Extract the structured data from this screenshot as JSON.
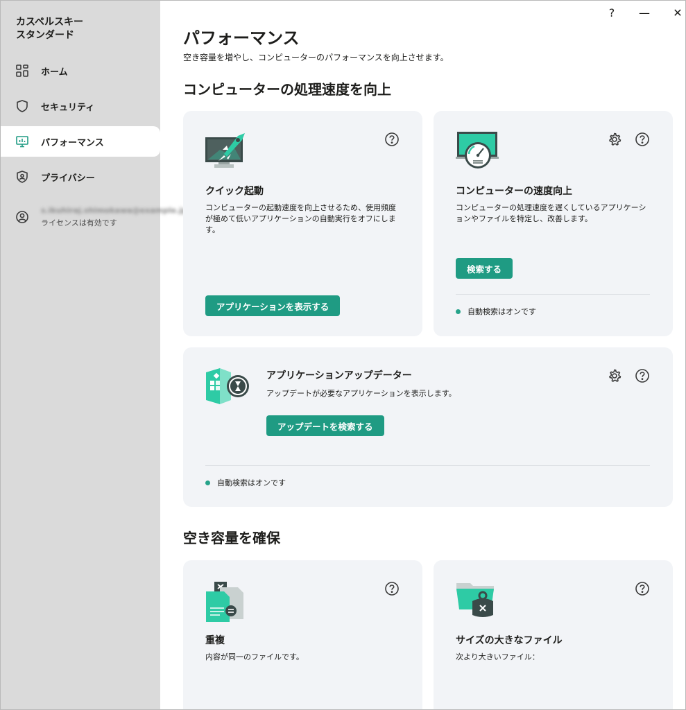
{
  "app": {
    "title": "カスペルスキー\nスタンダード",
    "window_controls": [
      "?",
      "—",
      "✕"
    ]
  },
  "sidebar": {
    "items": [
      {
        "label": "ホーム",
        "icon": "grid-icon"
      },
      {
        "label": "セキュリティ",
        "icon": "shield-icon"
      },
      {
        "label": "パフォーマンス",
        "icon": "monitor-icon",
        "active": true
      },
      {
        "label": "プライバシー",
        "icon": "privacy-shield-icon"
      }
    ],
    "account": {
      "email": "s.ikuhiraj.shimokawa@example.jp",
      "status": "ライセンスは有効です"
    }
  },
  "main": {
    "title": "パフォーマンス",
    "subtitle": "空き容量を増やし、コンピューターのパフォーマンスを向上させます。",
    "section1": "コンピューターの処理速度を向上",
    "section2": "空き容量を確保",
    "cards": {
      "quick_start": {
        "title": "クイック起動",
        "desc": "コンピューターの起動速度を向上させるため、使用頻度が極めて低いアプリケーションの自動実行をオフにします。",
        "button": "アプリケーションを表示する"
      },
      "speed_up": {
        "title": "コンピューターの速度向上",
        "desc": "コンピューターの処理速度を遅くしているアプリケーションやファイルを特定し、改善します。",
        "button": "検索する",
        "status": "自動検索はオンです"
      },
      "app_updater": {
        "title": "アプリケーションアップデーター",
        "desc": "アップデートが必要なアプリケーションを表示します。",
        "button": "アップデートを検索する",
        "status": "自動検索はオンです"
      },
      "duplicates": {
        "title": "重複",
        "desc": "内容が同一のファイルです。"
      },
      "large_files": {
        "title": "サイズの大きなファイル",
        "desc": "次より大きいファイル："
      }
    }
  },
  "colors": {
    "accent": "#1f9b83",
    "sidebar_bg": "#dadada",
    "card_bg": "#f2f4f7",
    "icon_dark": "#3a4a49",
    "icon_mint": "#2ecba5"
  }
}
